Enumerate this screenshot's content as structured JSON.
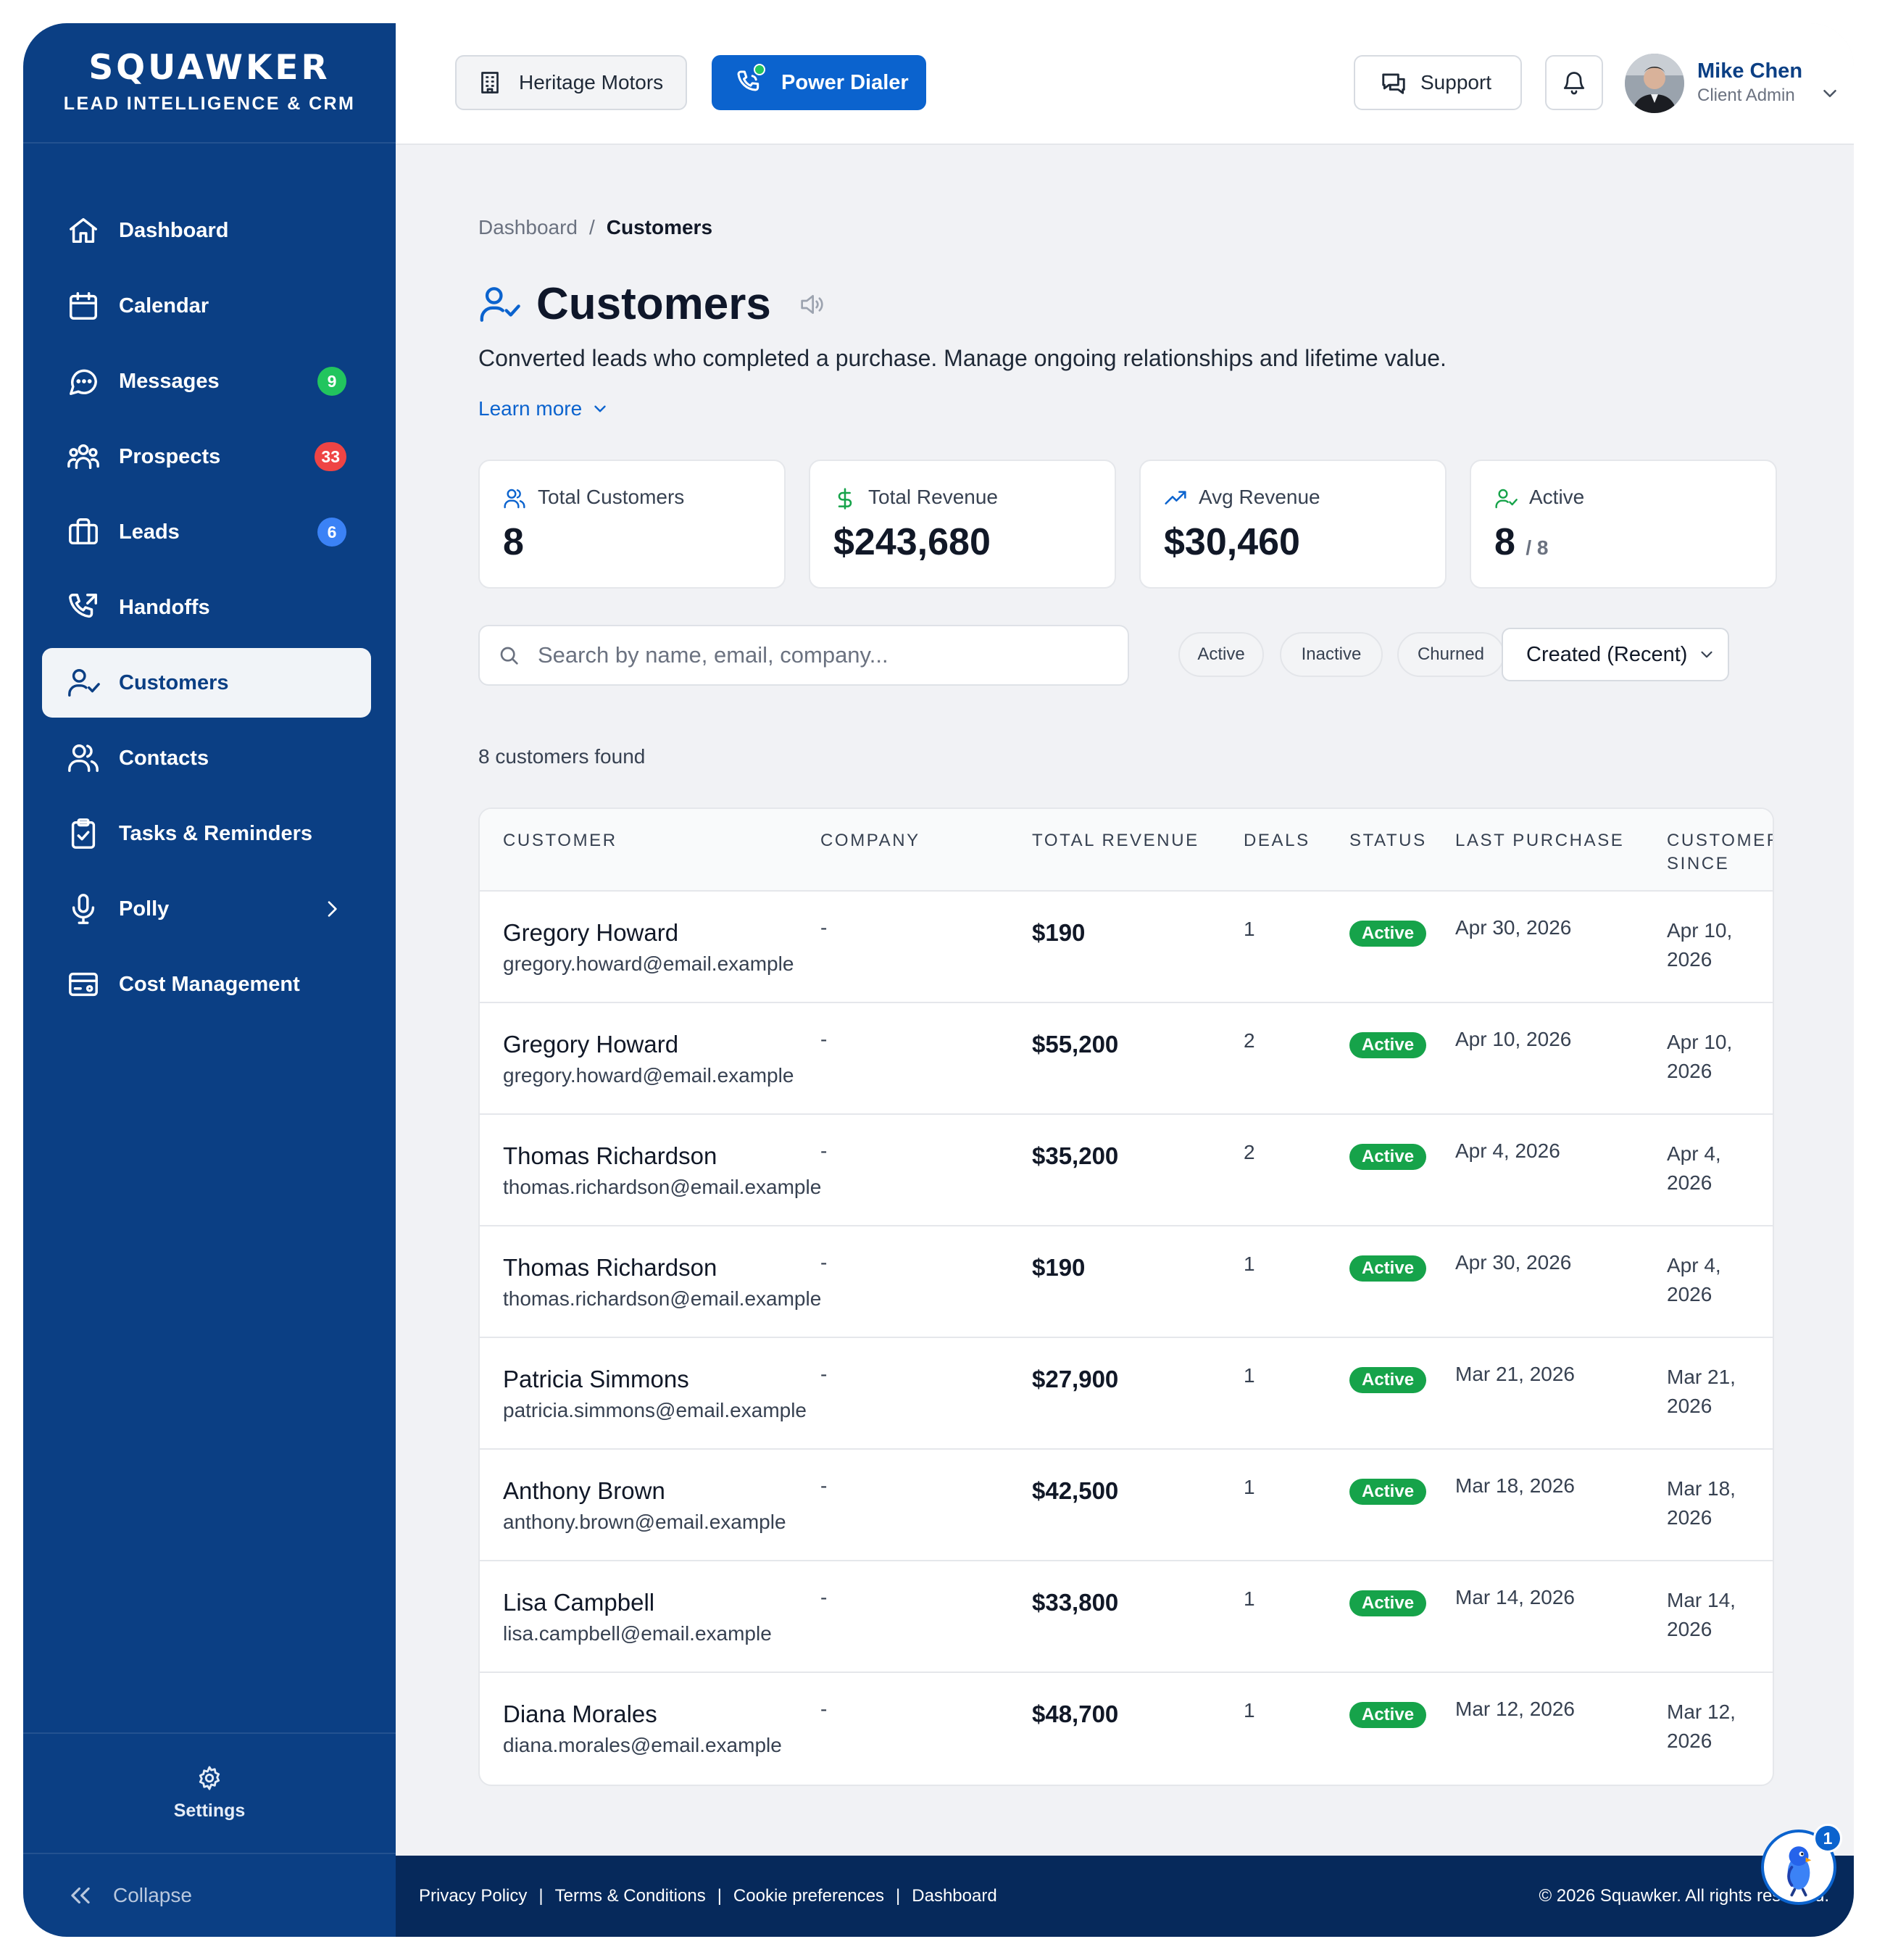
{
  "brand": {
    "name": "SQUAWKER",
    "tagline": "LEAD INTELLIGENCE & CRM"
  },
  "sidebar": {
    "items": [
      {
        "label": "Dashboard",
        "icon": "home-icon"
      },
      {
        "label": "Calendar",
        "icon": "calendar-icon"
      },
      {
        "label": "Messages",
        "icon": "message-icon",
        "badge": "9",
        "badge_color": "#22c55e"
      },
      {
        "label": "Prospects",
        "icon": "users-icon",
        "badge": "33",
        "badge_color": "#ef4444"
      },
      {
        "label": "Leads",
        "icon": "briefcase-icon",
        "badge": "6",
        "badge_color": "#3b82f6"
      },
      {
        "label": "Handoffs",
        "icon": "phone-forward-icon"
      },
      {
        "label": "Customers",
        "icon": "user-check-icon",
        "active": true
      },
      {
        "label": "Contacts",
        "icon": "contacts-icon"
      },
      {
        "label": "Tasks & Reminders",
        "icon": "clipboard-check-icon"
      },
      {
        "label": "Polly",
        "icon": "microphone-icon",
        "has_submenu": true
      },
      {
        "label": "Cost Management",
        "icon": "credit-card-icon"
      }
    ],
    "settings_label": "Settings",
    "collapse_label": "Collapse"
  },
  "header": {
    "dealer_label": "Heritage Motors",
    "dialer_label": "Power Dialer",
    "support_label": "Support",
    "user": {
      "name": "Mike Chen",
      "role": "Client Admin"
    }
  },
  "breadcrumb": {
    "parent": "Dashboard",
    "separator": "/",
    "current": "Customers"
  },
  "page": {
    "title": "Customers",
    "description": "Converted leads who completed a purchase. Manage ongoing relationships and lifetime value.",
    "learn_more": "Learn more"
  },
  "stats": [
    {
      "label": "Total Customers",
      "value": "8",
      "icon": "users-icon"
    },
    {
      "label": "Total Revenue",
      "value": "$243,680",
      "icon": "dollar-icon"
    },
    {
      "label": "Avg Revenue",
      "value": "$30,460",
      "icon": "trending-up-icon"
    },
    {
      "label": "Active",
      "value": "8",
      "sub": "/ 8",
      "icon": "user-check-icon"
    }
  ],
  "filters": {
    "search_placeholder": "Search by name, email, company...",
    "chips": [
      "Active",
      "Inactive",
      "Churned"
    ],
    "sort_value": "Created (Recent)"
  },
  "results_text": "8 customers found",
  "table": {
    "headers": [
      "CUSTOMER",
      "COMPANY",
      "TOTAL REVENUE",
      "DEALS",
      "STATUS",
      "LAST PURCHASE",
      "CUSTOMER SINCE"
    ],
    "rows": [
      {
        "name": "Gregory Howard",
        "email": "gregory.howard@email.example",
        "company": "-",
        "revenue": "$190",
        "deals": "1",
        "status": "Active",
        "last_purchase": "Apr 30, 2026",
        "since": "Apr 10, 2026"
      },
      {
        "name": "Gregory Howard",
        "email": "gregory.howard@email.example",
        "company": "-",
        "revenue": "$55,200",
        "deals": "2",
        "status": "Active",
        "last_purchase": "Apr 10, 2026",
        "since": "Apr 10, 2026"
      },
      {
        "name": "Thomas Richardson",
        "email": "thomas.richardson@email.example",
        "company": "-",
        "revenue": "$35,200",
        "deals": "2",
        "status": "Active",
        "last_purchase": "Apr 4, 2026",
        "since": "Apr 4, 2026"
      },
      {
        "name": "Thomas Richardson",
        "email": "thomas.richardson@email.example",
        "company": "-",
        "revenue": "$190",
        "deals": "1",
        "status": "Active",
        "last_purchase": "Apr 30, 2026",
        "since": "Apr 4, 2026"
      },
      {
        "name": "Patricia Simmons",
        "email": "patricia.simmons@email.example",
        "company": "-",
        "revenue": "$27,900",
        "deals": "1",
        "status": "Active",
        "last_purchase": "Mar 21, 2026",
        "since": "Mar 21, 2026"
      },
      {
        "name": "Anthony Brown",
        "email": "anthony.brown@email.example",
        "company": "-",
        "revenue": "$42,500",
        "deals": "1",
        "status": "Active",
        "last_purchase": "Mar 18, 2026",
        "since": "Mar 18, 2026"
      },
      {
        "name": "Lisa Campbell",
        "email": "lisa.campbell@email.example",
        "company": "-",
        "revenue": "$33,800",
        "deals": "1",
        "status": "Active",
        "last_purchase": "Mar 14, 2026",
        "since": "Mar 14, 2026"
      },
      {
        "name": "Diana Morales",
        "email": "diana.morales@email.example",
        "company": "-",
        "revenue": "$48,700",
        "deals": "1",
        "status": "Active",
        "last_purchase": "Mar 12, 2026",
        "since": "Mar 12, 2026"
      }
    ]
  },
  "footer": {
    "links": [
      "Privacy Policy",
      "Terms & Conditions",
      "Cookie preferences",
      "Dashboard"
    ],
    "copyright": "© 2026 Squawker. All rights reserved."
  },
  "assistant": {
    "badge": "1"
  },
  "colors": {
    "sidebar": "#0b3f84",
    "primary": "#0b63ce",
    "status_active": "#16a34a",
    "footer": "#06295b"
  }
}
